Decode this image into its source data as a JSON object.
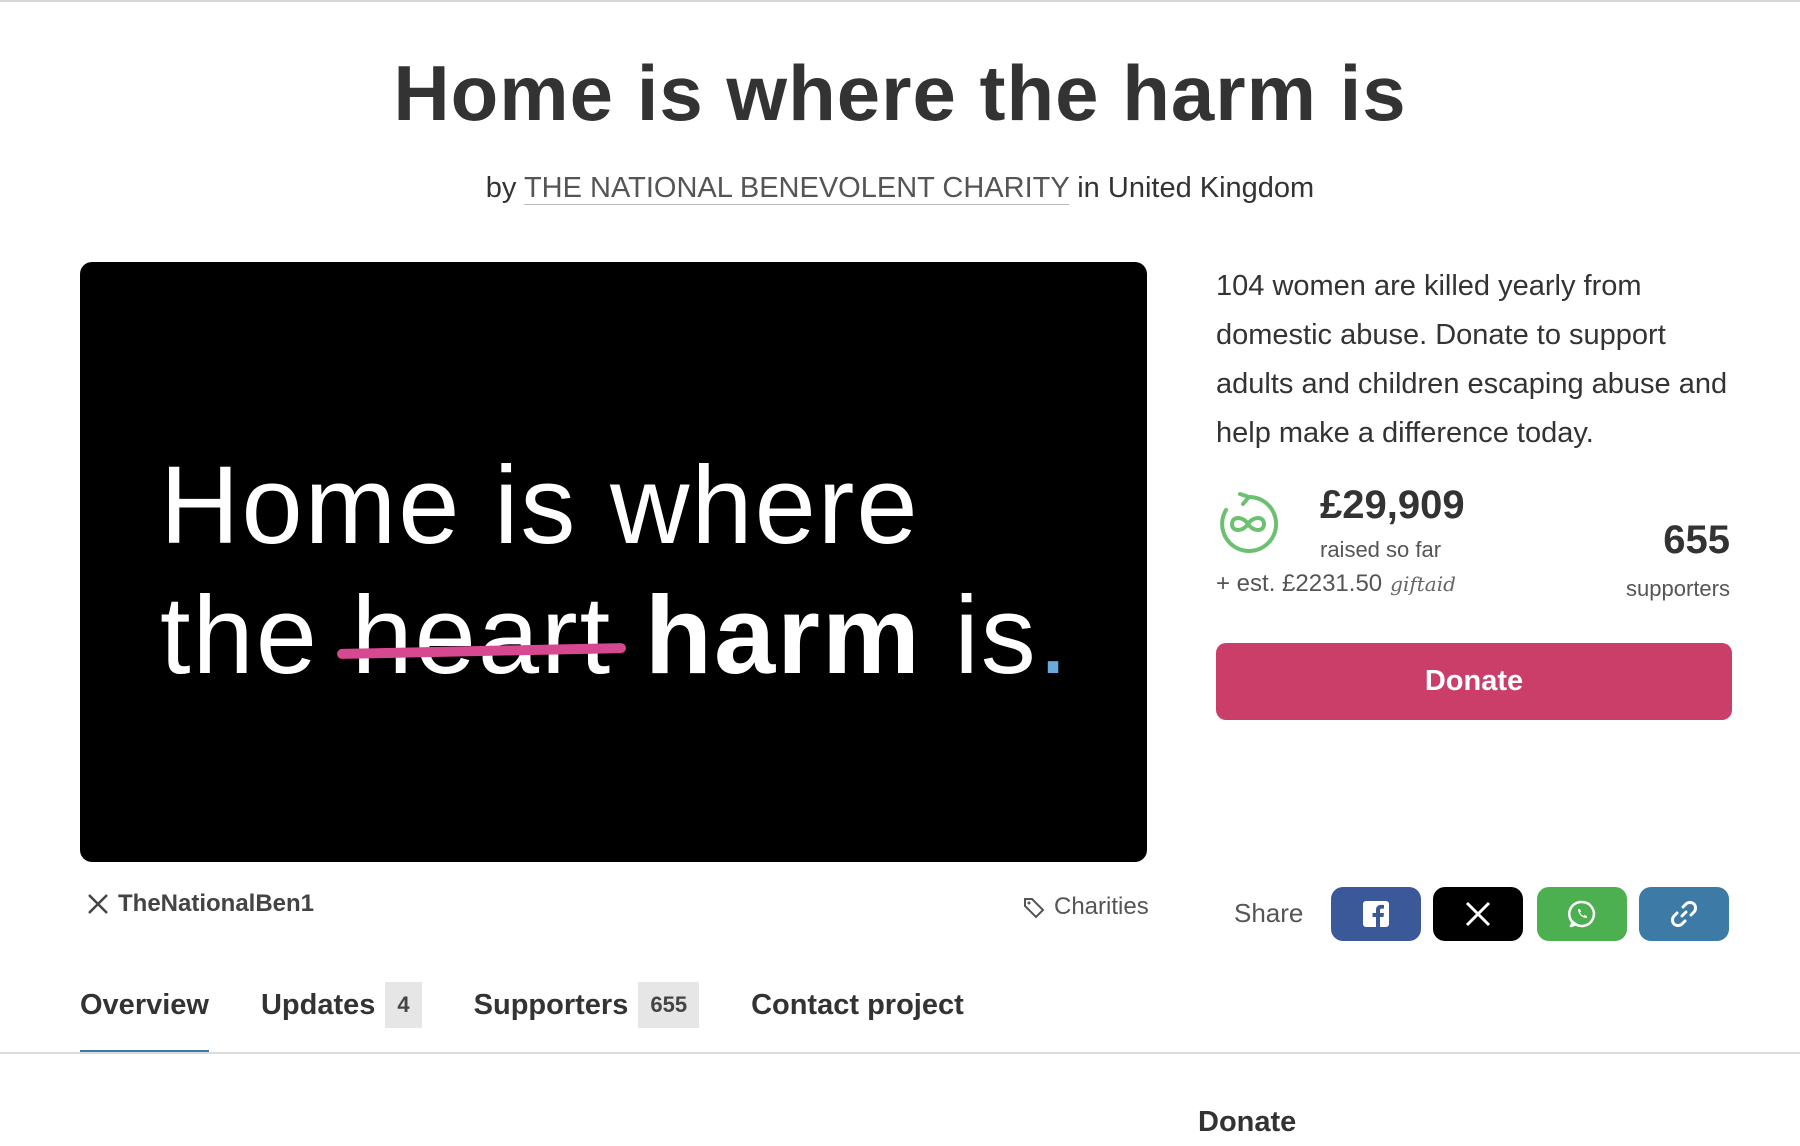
{
  "page": {
    "title": "Home is where the harm is",
    "byline": {
      "by": "by",
      "organisation": "THE NATIONAL BENEVOLENT CHARITY",
      "in": "in",
      "location": "United Kingdom"
    }
  },
  "hero": {
    "line1": "Home is where",
    "line2_the": "the",
    "line2_struck": "heart",
    "line2_harm": "harm",
    "line2_is": "is",
    "line2_dot": ".",
    "strike_color": "#d6488f",
    "dot_color": "#6aa9dc"
  },
  "meta": {
    "social_handle": "TheNationalBen1",
    "category": "Charities"
  },
  "summary": {
    "text": "104 women are killed yearly from domestic abuse. Donate to support adults and children escaping abuse and help make a difference today."
  },
  "funding": {
    "raised_amount": "£29,909",
    "raised_label": "raised so far",
    "giftaid_estimate": "+ est. £2231.50",
    "giftaid_mark": "giftaid",
    "supporters_count": "655",
    "supporters_label": "supporters",
    "icon": "recurring-infinity-icon",
    "icon_color": "#6cc070"
  },
  "donate_button": {
    "label": "Donate",
    "color": "#cc3e6a"
  },
  "share": {
    "label": "Share",
    "buttons": [
      {
        "name": "facebook",
        "icon": "facebook-icon",
        "color": "#3b5998"
      },
      {
        "name": "x",
        "icon": "x-icon",
        "color": "#000000"
      },
      {
        "name": "whatsapp",
        "icon": "whatsapp-icon",
        "color": "#4caf50"
      },
      {
        "name": "copy-link",
        "icon": "link-icon",
        "color": "#3d7aa6"
      }
    ]
  },
  "tabs": [
    {
      "label": "Overview",
      "active": true
    },
    {
      "label": "Updates",
      "count": "4"
    },
    {
      "label": "Supporters",
      "count": "655"
    },
    {
      "label": "Contact project"
    }
  ],
  "footer": {
    "donate_heading": "Donate"
  },
  "accent_color": "#3d7aa6"
}
